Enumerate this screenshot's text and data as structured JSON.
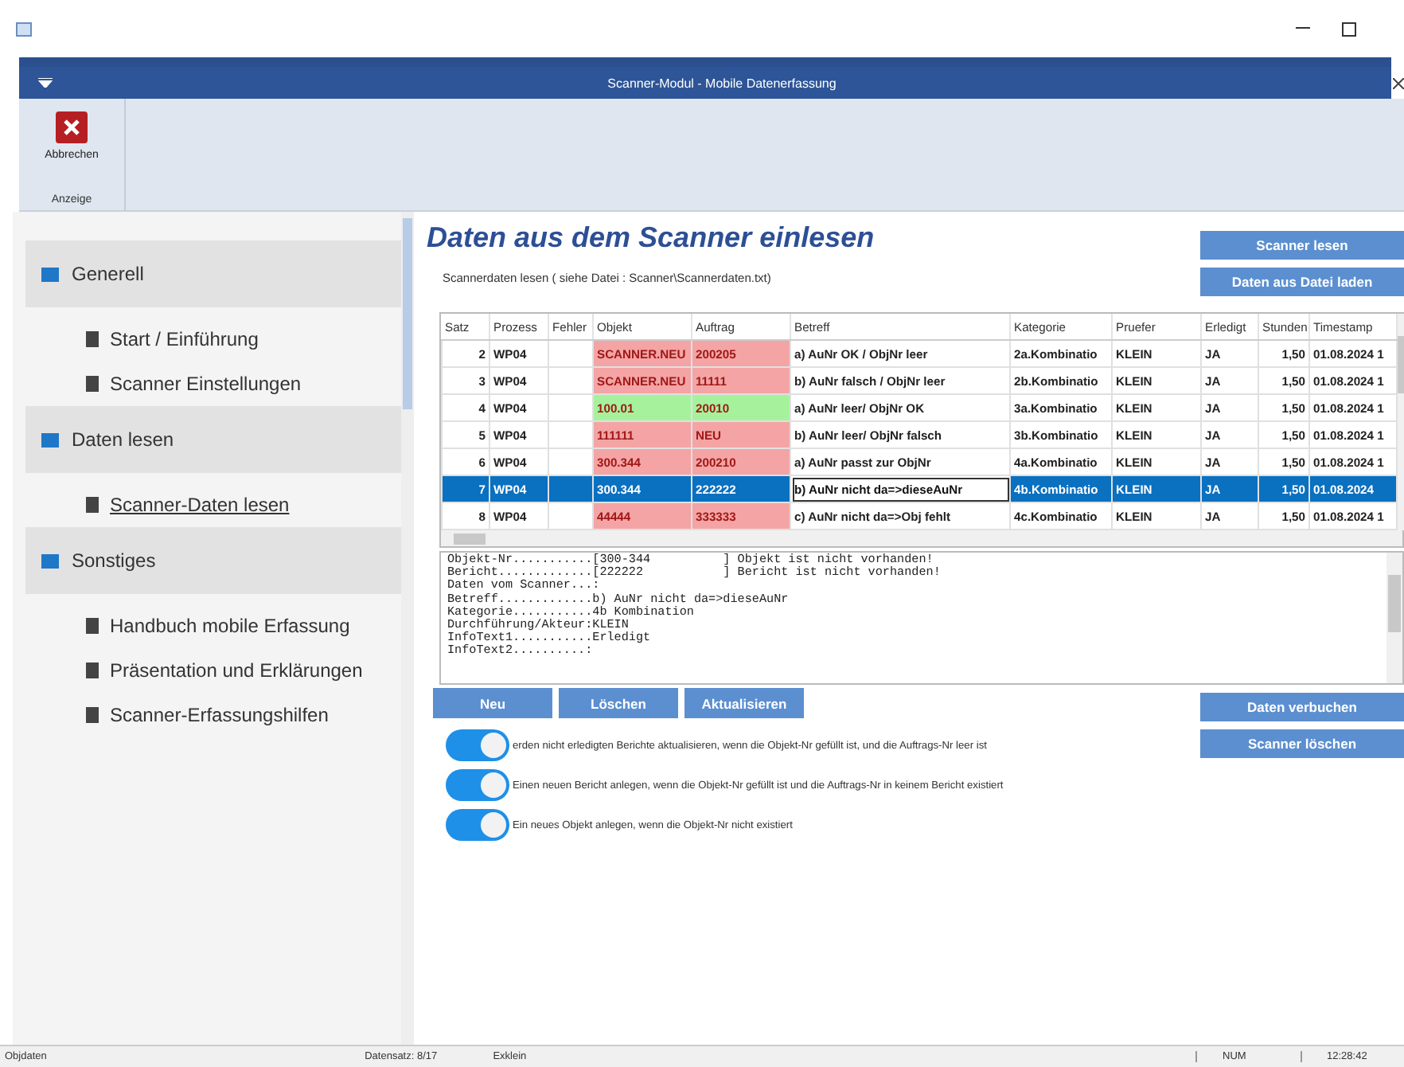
{
  "window": {
    "title": "Scanner-Modul - Mobile Datenerfassung"
  },
  "ribbon": {
    "button": "Abbrechen",
    "group": "Anzeige"
  },
  "sidebar": {
    "groups": [
      {
        "label": "Generell",
        "items": [
          {
            "label": "Start / Einführung",
            "selected": false
          },
          {
            "label": "Scanner Einstellungen",
            "selected": false
          }
        ]
      },
      {
        "label": "Daten lesen",
        "items": [
          {
            "label": "Scanner-Daten lesen",
            "selected": true
          }
        ]
      },
      {
        "label": "Sonstiges",
        "items": [
          {
            "label": "Handbuch mobile Erfassung",
            "selected": false
          },
          {
            "label": "Präsentation und Erklärungen",
            "selected": false
          },
          {
            "label": "Scanner-Erfassungshilfen",
            "selected": false
          }
        ]
      }
    ]
  },
  "heading": "Daten aus dem Scanner einlesen",
  "subtitle": "Scannerdaten lesen ( siehe Datei :  Scanner\\Scannerdaten.txt)",
  "top_buttons": [
    "Scanner lesen",
    "Daten aus Datei laden"
  ],
  "table": {
    "columns": [
      "Satz",
      "Prozess",
      "Fehler",
      "Objekt",
      "Auftrag",
      "Betreff",
      "Kategorie",
      "Pruefer",
      "Erledigt",
      "Stunden",
      "Timestamp"
    ],
    "rows": [
      {
        "selected": false,
        "editing": false,
        "color": "#f4a4a4",
        "cells": [
          "2",
          "WP04",
          "",
          "SCANNER.NEU",
          "200205",
          "a) AuNr OK / ObjNr leer",
          "2a.Kombinatio",
          "KLEIN",
          "JA",
          "1,50",
          "01.08.2024 1"
        ]
      },
      {
        "selected": false,
        "editing": false,
        "color": "#f4a4a4",
        "cells": [
          "3",
          "WP04",
          "",
          "SCANNER.NEU",
          "11111",
          "b) AuNr falsch / ObjNr leer",
          "2b.Kombinatio",
          "KLEIN",
          "JA",
          "1,50",
          "01.08.2024 1"
        ]
      },
      {
        "selected": false,
        "editing": false,
        "color": "#a6f29c",
        "cells": [
          "4",
          "WP04",
          "",
          "100.01",
          "20010",
          "a) AuNr leer/ ObjNr OK",
          "3a.Kombinatio",
          "KLEIN",
          "JA",
          "1,50",
          "01.08.2024 1"
        ]
      },
      {
        "selected": false,
        "editing": false,
        "color": "#f4a4a4",
        "cells": [
          "5",
          "WP04",
          "",
          "111111",
          "NEU",
          "b) AuNr leer/ ObjNr falsch",
          "3b.Kombinatio",
          "KLEIN",
          "JA",
          "1,50",
          "01.08.2024 1"
        ]
      },
      {
        "selected": false,
        "editing": false,
        "color": "#f4a4a4",
        "cells": [
          "6",
          "WP04",
          "",
          "300.344",
          "200210",
          "a) AuNr passt zur ObjNr",
          "4a.Kombinatio",
          "KLEIN",
          "JA",
          "1,50",
          "01.08.2024 1"
        ]
      },
      {
        "selected": true,
        "editing": true,
        "cells": [
          "7",
          "WP04",
          "",
          "300.344",
          "222222",
          "b) AuNr nicht da=>dieseAuNr",
          "4b.Kombinatio",
          "KLEIN",
          "JA",
          "1,50",
          "01.08.2024"
        ]
      },
      {
        "selected": false,
        "editing": false,
        "color": "#f4a4a4",
        "cells": [
          "8",
          "WP04",
          "",
          "44444",
          "333333",
          "c) AuNr nicht da=>Obj fehlt",
          "4c.Kombinatio",
          "KLEIN",
          "JA",
          "1,50",
          "01.08.2024 1"
        ]
      }
    ]
  },
  "details": [
    "Objekt-Nr...........[300-344          ] Objekt ist nicht vorhanden!",
    "Bericht.............[222222           ] Bericht ist nicht vorhanden!",
    "Daten vom Scanner...:",
    "Betreff.............b) AuNr nicht da=>dieseAuNr",
    "Kategorie...........4b Kombination",
    "Durchführung/Akteur:KLEIN",
    "InfoText1...........Erledigt",
    "InfoText2..........:"
  ],
  "action_buttons": [
    "Neu",
    "Löschen",
    "Aktualisieren"
  ],
  "side_buttons": [
    "Daten verbuchen",
    "Scanner löschen"
  ],
  "toggles": [
    {
      "label": "erden nicht erledigten Berichte aktualisieren, wenn die Objekt-Nr gefüllt ist, und die Auftrags-Nr leer ist",
      "on": true
    },
    {
      "label": "Einen neuen Bericht anlegen, wenn die Objekt-Nr gefüllt ist und die Auftrags-Nr in keinem Bericht existiert",
      "on": true
    },
    {
      "label": "Ein neues Objekt anlegen, wenn die Objekt-Nr nicht existiert",
      "on": true
    }
  ],
  "status_bar": {
    "left": "Objdaten",
    "record": "Datensatz: 8/17",
    "user": "Exklein",
    "num": "NUM",
    "time": "12:28:42"
  }
}
